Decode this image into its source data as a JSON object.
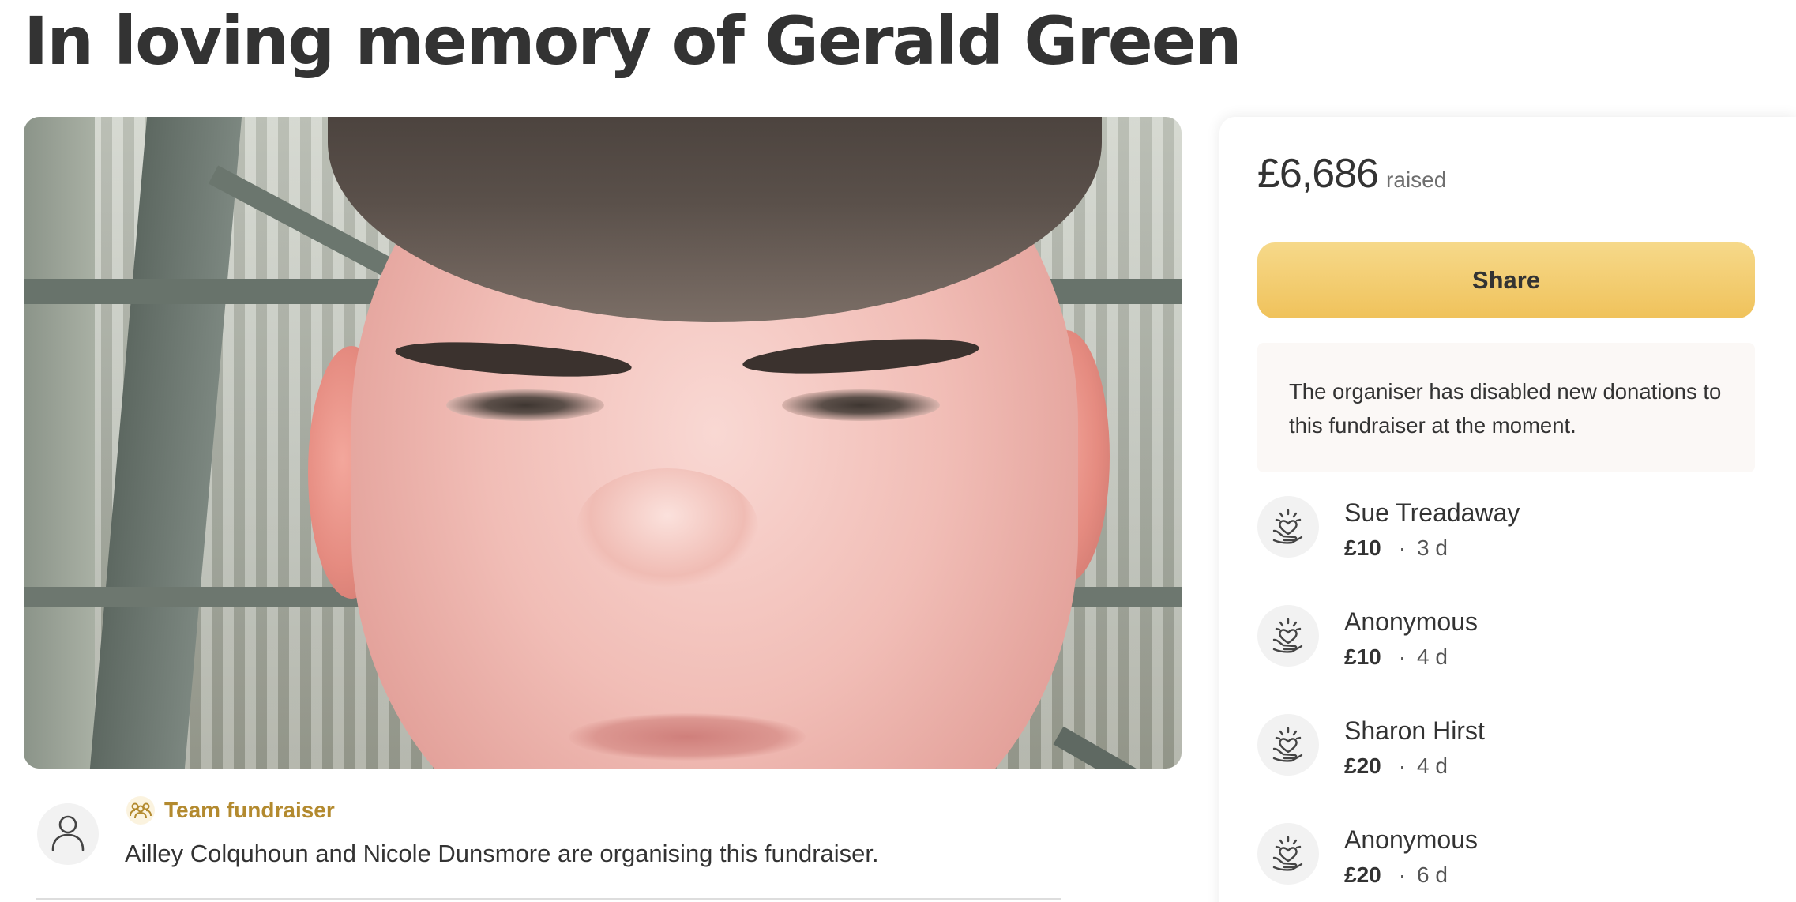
{
  "fundraiser": {
    "title": "In loving memory of Gerald Green",
    "organiser": {
      "team_label": "Team fundraiser",
      "text": "Ailley Colquhoun and Nicole Dunsmore are organising this fundraiser."
    }
  },
  "sidebar": {
    "amount_raised": "£6,686",
    "raised_label": "raised",
    "share_label": "Share",
    "notice": "The organiser has disabled new donations to this fundraiser at the moment.",
    "donations": [
      {
        "name": "Sue Treadaway",
        "amount": "£10",
        "separator": "·",
        "time": "3 d"
      },
      {
        "name": "Anonymous",
        "amount": "£10",
        "separator": "·",
        "time": "4 d"
      },
      {
        "name": "Sharon Hirst",
        "amount": "£20",
        "separator": "·",
        "time": "4 d"
      },
      {
        "name": "Anonymous",
        "amount": "£20",
        "separator": "·",
        "time": "6 d"
      }
    ]
  },
  "icons": {
    "organiser_avatar": "user-icon",
    "team": "team-icon",
    "donation": "heart-hand-icon"
  },
  "colors": {
    "share_button": "#f0c25b",
    "team_label": "#b38a2f",
    "notice_background": "#fbf8f6"
  }
}
